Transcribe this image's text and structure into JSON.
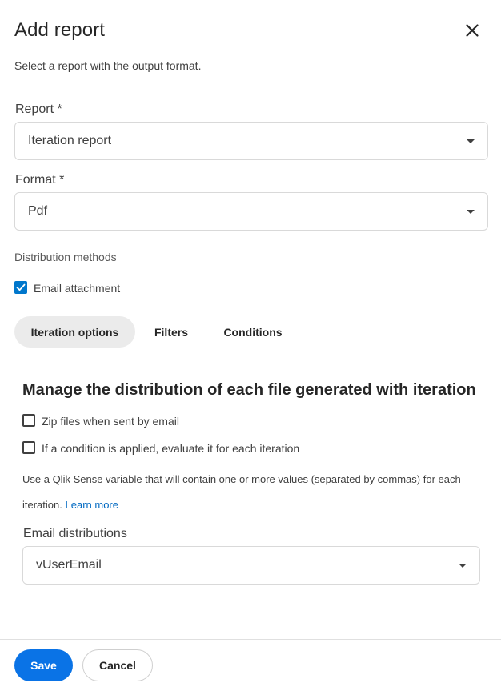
{
  "dialog": {
    "title": "Add report",
    "subtitle": "Select a report with the output format.",
    "close_icon": "close-icon"
  },
  "report": {
    "label": "Report *",
    "value": "Iteration report"
  },
  "format": {
    "label": "Format *",
    "value": "Pdf"
  },
  "distribution": {
    "label": "Distribution methods",
    "email_attachment": {
      "label": "Email attachment",
      "checked": true
    }
  },
  "tabs": [
    {
      "label": "Iteration options",
      "active": true
    },
    {
      "label": "Filters",
      "active": false
    },
    {
      "label": "Conditions",
      "active": false
    }
  ],
  "iteration": {
    "heading": "Manage the distribution of each file generated with iteration",
    "zip_files": {
      "label": "Zip files when sent by email",
      "checked": false
    },
    "evaluate_condition": {
      "label": "If a condition is applied, evaluate it for each iteration",
      "checked": false
    },
    "help_line1": "Use a Qlik Sense variable that will contain one or more values (separated by commas) for each",
    "help_line2": "iteration.",
    "learn_more": "Learn more",
    "email_distributions": {
      "label": "Email distributions",
      "value": "vUserEmail"
    }
  },
  "footer": {
    "save": "Save",
    "cancel": "Cancel"
  },
  "colors": {
    "primary": "#0a73e6",
    "checkbox": "#0077cc",
    "link": "#0069c2",
    "active_tab": "#ebebeb"
  }
}
